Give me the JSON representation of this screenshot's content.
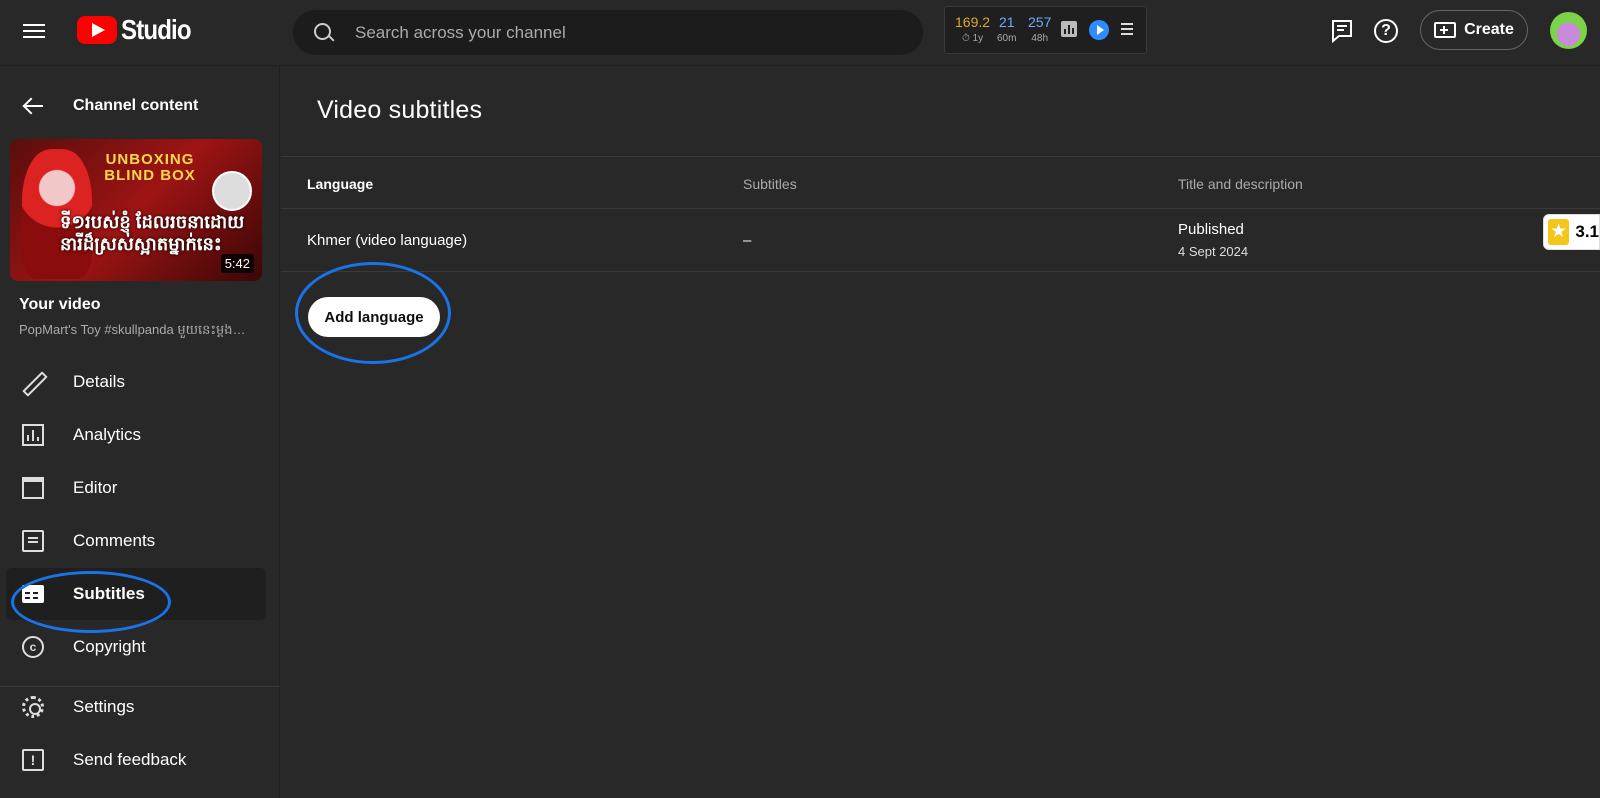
{
  "header": {
    "logo_text": "Studio",
    "search_placeholder": "Search across your channel",
    "stats": {
      "views": "169.2",
      "views_sub": "⏱ 1y",
      "subs": "21",
      "subs_sub": "60m",
      "hours": "257",
      "hours_sub": "48h"
    },
    "create_label": "Create"
  },
  "sidebar": {
    "back_label": "Channel content",
    "thumbnail": {
      "headline": "UNBOXING BLIND BOX",
      "khmer_text": "ទី១របស់ខ្ញុំ ដែលរចនាដោយនារីដ៏ស្រស់ស្អាតម្នាក់នេះ",
      "duration": "5:42"
    },
    "your_video_label": "Your video",
    "video_title": "PopMart's Toy #skullpanda មួយនេះម្ដង…",
    "items": [
      {
        "label": "Details",
        "icon": "pencil-icon"
      },
      {
        "label": "Analytics",
        "icon": "analytics-icon"
      },
      {
        "label": "Editor",
        "icon": "clapperboard-icon"
      },
      {
        "label": "Comments",
        "icon": "comments-icon"
      },
      {
        "label": "Subtitles",
        "icon": "subtitles-icon",
        "active": true
      },
      {
        "label": "Copyright",
        "icon": "copyright-icon"
      }
    ],
    "footer_items": [
      {
        "label": "Settings",
        "icon": "gear-icon"
      },
      {
        "label": "Send feedback",
        "icon": "feedback-icon"
      }
    ]
  },
  "main": {
    "page_title": "Video subtitles",
    "table": {
      "headers": [
        "Language",
        "Subtitles",
        "Title and description"
      ],
      "rows": [
        {
          "language": "Khmer (video language)",
          "subtitles": "–",
          "status": "Published",
          "date": "4 Sept 2024"
        }
      ]
    },
    "add_language_label": "Add language",
    "rating_chip": "3.1"
  },
  "colors": {
    "background": "#282828",
    "accent_blue": "#1a73e8",
    "brand_red": "#ff0000",
    "views_color": "#e1a432"
  }
}
